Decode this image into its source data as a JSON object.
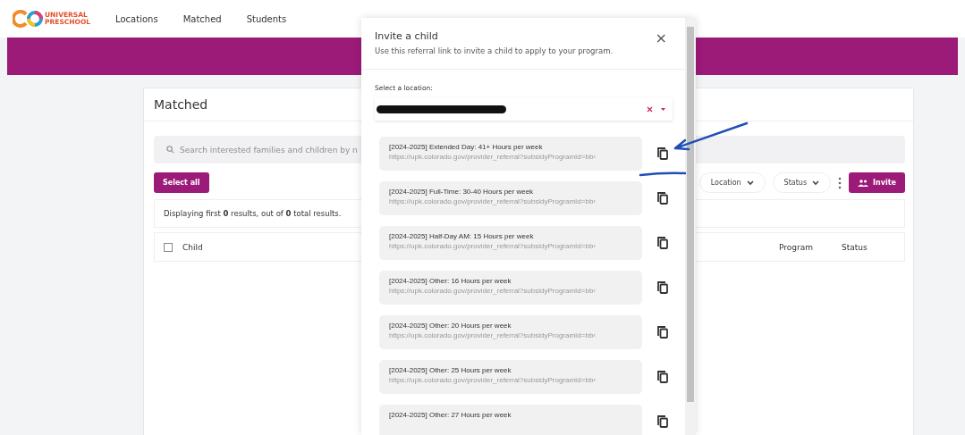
{
  "nav": {
    "logo_lines": [
      "UNIVERSAL",
      "PRESCHOOL"
    ],
    "links": [
      {
        "label": "Locations",
        "selected": false
      },
      {
        "label": "Matched",
        "selected": false
      },
      {
        "label": "Students",
        "selected": false
      }
    ]
  },
  "card": {
    "title": "Matched",
    "search": {
      "placeholder": "Search interested families and children by n"
    },
    "select_all": "Select all",
    "filters": [
      "Location",
      "Status"
    ],
    "invite": "Invite",
    "results": "Displaying first **0** results, out of **0** total results.",
    "columns": [
      {
        "label": "Child",
        "kind": "check",
        "checked": false
      },
      {
        "label": "Program",
        "kind": "plain"
      },
      {
        "label": "Status",
        "kind": "plain"
      }
    ]
  },
  "modal": {
    "title": "Invite a child",
    "subtitle": "Use this referral link to invite a child to apply to your program.",
    "close": "×",
    "location_label": "Select a location:",
    "links": [
      {
        "name": "[2024-2025] Extended Day: 41+ Hours per week",
        "url": "https://upk.colorado.gov/provider_referral?subsidyProgramId=bb‹"
      },
      {
        "name": "[2024-2025] Full-Time: 30-40 Hours per week",
        "url": "https://upk.colorado.gov/provider_referral?subsidyProgramId=bb‹"
      },
      {
        "name": "[2024-2025] Half-Day AM: 15 Hours per week",
        "url": "https://upk.colorado.gov/provider_referral?subsidyProgramId=bb‹"
      },
      {
        "name": "[2024-2025] Other: 16 Hours per week",
        "url": "https://upk.colorado.gov/provider_referral?subsidyProgramId=bb‹"
      },
      {
        "name": "[2024-2025] Other: 20 Hours per week",
        "url": "https://upk.colorado.gov/provider_referral?subsidyProgramId=bb‹"
      },
      {
        "name": "[2024-2025] Other: 25 Hours per week",
        "url": "https://upk.colorado.gov/provider_referral?subsidyProgramId=bb‹"
      },
      {
        "name": "[2024-2025] Other: 27 Hours per week"
      }
    ]
  }
}
